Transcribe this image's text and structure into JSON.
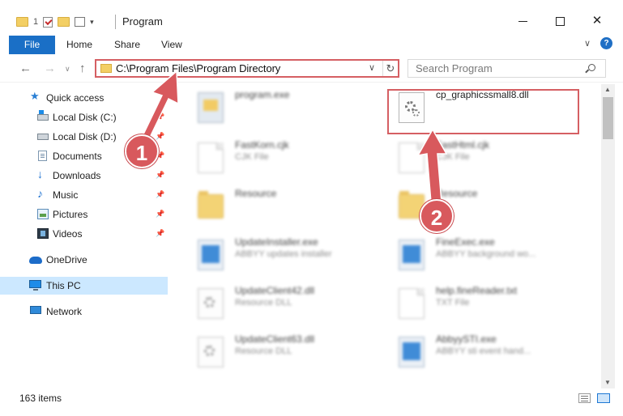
{
  "window": {
    "title": "Program",
    "qat_counter": "1"
  },
  "ribbon": {
    "tabs": [
      "File",
      "Home",
      "Share",
      "View"
    ]
  },
  "navigation": {
    "address": "C:\\Program Files\\Program Directory",
    "search_placeholder": "Search Program"
  },
  "sidebar": {
    "items": [
      {
        "label": "Quick access",
        "icon": "star-icon"
      },
      {
        "label": "Local Disk (C:)",
        "icon": "drive-icon",
        "pinned": true
      },
      {
        "label": "Local Disk (D:)",
        "icon": "drive-icon",
        "pinned": true
      },
      {
        "label": "Documents",
        "icon": "documents-icon",
        "pinned": true
      },
      {
        "label": "Downloads",
        "icon": "download-icon",
        "pinned": true
      },
      {
        "label": "Music",
        "icon": "music-icon",
        "pinned": true
      },
      {
        "label": "Pictures",
        "icon": "pictures-icon",
        "pinned": true
      },
      {
        "label": "Videos",
        "icon": "videos-icon",
        "pinned": true
      },
      {
        "label": "OneDrive",
        "icon": "cloud-icon"
      },
      {
        "label": "This PC",
        "icon": "computer-icon",
        "selected": true
      },
      {
        "label": "Network",
        "icon": "network-icon"
      }
    ]
  },
  "files": [
    {
      "name": "program.exe",
      "type": "",
      "icon": "program-icon",
      "col": 0,
      "row": 0
    },
    {
      "name": "cp_graphicssmall8.dll",
      "type": "",
      "icon": "dll-icon",
      "col": 1,
      "row": 0
    },
    {
      "name": "FastKorn.cjk",
      "type": "CJK File",
      "icon": "page-icon",
      "col": 0,
      "row": 1
    },
    {
      "name": "FastHtml.cjk",
      "type": "CJK File",
      "icon": "page-icon",
      "col": 1,
      "row": 1
    },
    {
      "name": "Resource",
      "type": "",
      "icon": "folder-icon",
      "col": 0,
      "row": 2
    },
    {
      "name": "Resource",
      "type": "",
      "icon": "folder-icon",
      "col": 1,
      "row": 2
    },
    {
      "name": "UpdateInstaller.exe",
      "type": "ABBYY updates installer",
      "icon": "exe-icon",
      "col": 0,
      "row": 3
    },
    {
      "name": "FineExec.exe",
      "type": "ABBYY background wo...",
      "icon": "exe-icon",
      "col": 1,
      "row": 3
    },
    {
      "name": "UpdateClient42.dll",
      "type": "Resource DLL",
      "icon": "dll-icon",
      "col": 0,
      "row": 4
    },
    {
      "name": "help.fineReader.txt",
      "type": "TXT File",
      "icon": "page-icon",
      "col": 1,
      "row": 4
    },
    {
      "name": "UpdateClient63.dll",
      "type": "Resource DLL",
      "icon": "dll-icon",
      "col": 0,
      "row": 5
    },
    {
      "name": "AbbyySTI.exe",
      "type": "ABBYY sti event hand...",
      "icon": "exe-icon",
      "col": 1,
      "row": 5
    }
  ],
  "status": {
    "item_count": "163 items"
  },
  "annotations": [
    "1",
    "2"
  ],
  "colors": {
    "accent": "#1a6fc6",
    "highlight": "#d55f63",
    "selected": "#cce8ff"
  }
}
